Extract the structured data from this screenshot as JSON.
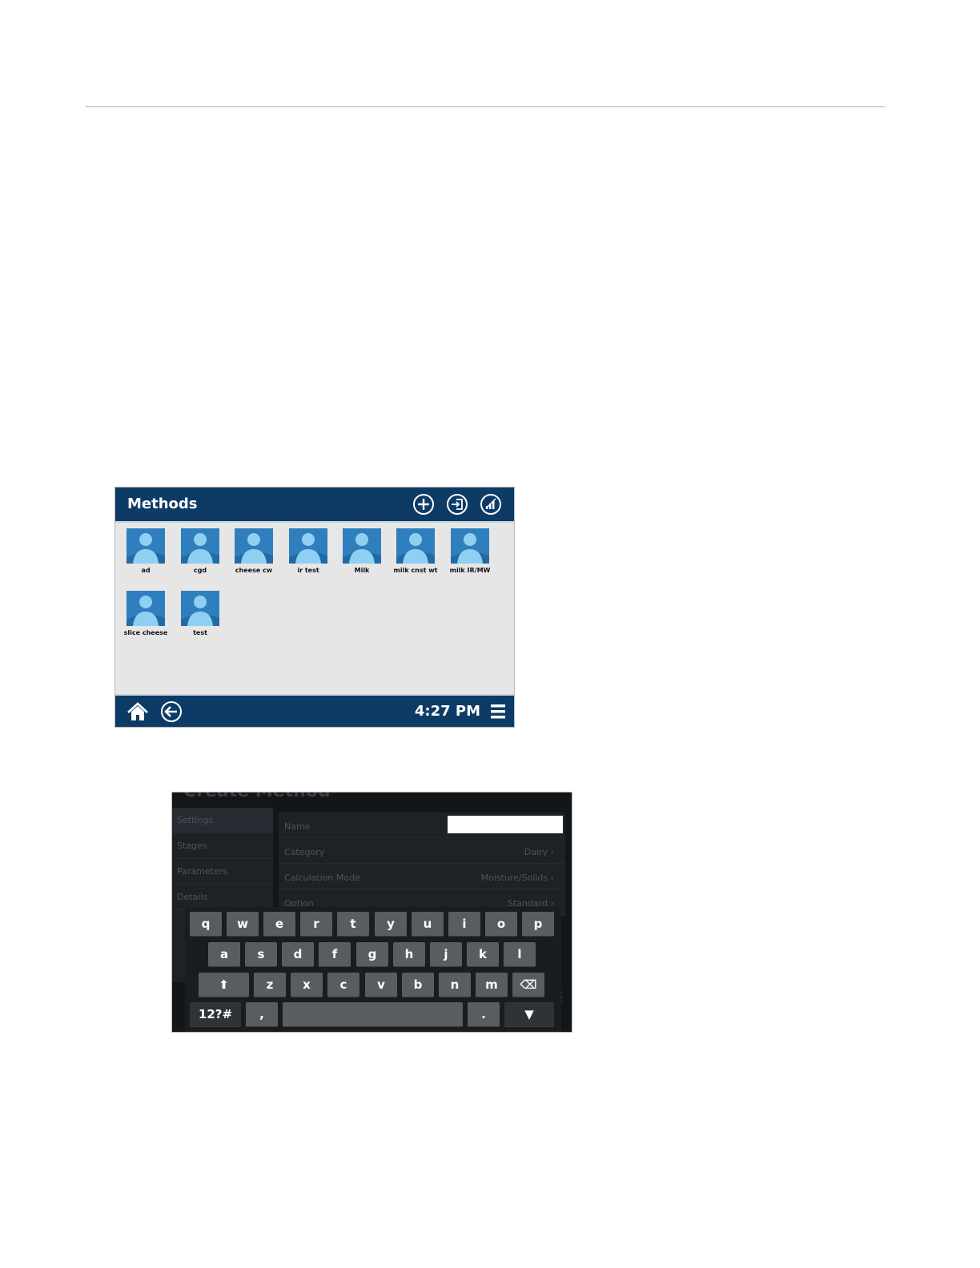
{
  "methods_screen": {
    "title": "Methods",
    "header_icons": [
      "add-circle-icon",
      "import-icon",
      "signal-stats-icon"
    ],
    "methods": [
      {
        "label": "ad"
      },
      {
        "label": "cgd"
      },
      {
        "label": "cheese cw"
      },
      {
        "label": "ir test"
      },
      {
        "label": "Milk"
      },
      {
        "label": "milk cnst wt"
      },
      {
        "label": "milk IR/MW"
      },
      {
        "label": "slice cheese"
      },
      {
        "label": "test"
      }
    ],
    "footer": {
      "time": "4:27 PM",
      "icons": [
        "home-icon",
        "back-arrow-icon",
        "menu-icon"
      ]
    },
    "colors": {
      "header": "#0e3b66",
      "body": "#e6e6e6",
      "avatar_bg": "#2f7fbf",
      "avatar_fg": "#8fd0f2"
    }
  },
  "create_method_screen": {
    "title": "Create Method",
    "sidebar": [
      "Settings",
      "Stages",
      "Parameters",
      "Details"
    ],
    "rows": [
      {
        "label": "Name",
        "value": ""
      },
      {
        "label": "Category",
        "value": "Dairy ›"
      },
      {
        "label": "Calculation Mode",
        "value": "Moisture/Solids ›"
      },
      {
        "label": "Option",
        "value": "Standard ›"
      }
    ],
    "keyboard": {
      "row1": [
        "q",
        "w",
        "e",
        "r",
        "t",
        "y",
        "u",
        "i",
        "o",
        "p"
      ],
      "row2": [
        "a",
        "s",
        "d",
        "f",
        "g",
        "h",
        "j",
        "k",
        "l"
      ],
      "row3": [
        "⬆",
        "z",
        "x",
        "c",
        "v",
        "b",
        "n",
        "m",
        "⌫"
      ],
      "row4": [
        "12?#",
        ",",
        "",
        ".",
        "▼"
      ]
    }
  }
}
